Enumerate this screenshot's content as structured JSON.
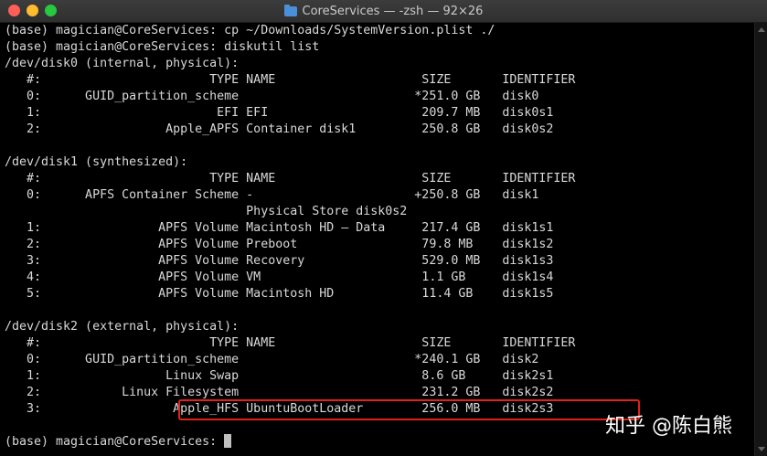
{
  "window": {
    "title": "CoreServices — -zsh — 92×26"
  },
  "terminal": {
    "lines": [
      "(base) magician@CoreServices: cp ~/Downloads/SystemVersion.plist ./",
      "(base) magician@CoreServices: diskutil list",
      "/dev/disk0 (internal, physical):",
      "   #:                       TYPE NAME                    SIZE       IDENTIFIER",
      "   0:      GUID_partition_scheme                        *251.0 GB   disk0",
      "   1:                        EFI EFI                     209.7 MB   disk0s1",
      "   2:                 Apple_APFS Container disk1         250.8 GB   disk0s2",
      "",
      "/dev/disk1 (synthesized):",
      "   #:                       TYPE NAME                    SIZE       IDENTIFIER",
      "   0:      APFS Container Scheme -                      +250.8 GB   disk1",
      "                                 Physical Store disk0s2",
      "   1:                APFS Volume Macintosh HD — Data     217.4 GB   disk1s1",
      "   2:                APFS Volume Preboot                 79.8 MB    disk1s2",
      "   3:                APFS Volume Recovery                529.0 MB   disk1s3",
      "   4:                APFS Volume VM                      1.1 GB     disk1s4",
      "   5:                APFS Volume Macintosh HD            11.4 GB    disk1s5",
      "",
      "/dev/disk2 (external, physical):",
      "   #:                       TYPE NAME                    SIZE       IDENTIFIER",
      "   0:      GUID_partition_scheme                        *240.1 GB   disk2",
      "   1:                 Linux Swap                         8.6 GB     disk2s1",
      "   2:           Linux Filesystem                         231.2 GB   disk2s2",
      "   3:                  Apple_HFS UbuntuBootLoader        256.0 MB   disk2s3",
      "",
      "(base) magician@CoreServices: "
    ]
  },
  "watermark": {
    "text": "知乎 @陈白熊"
  },
  "colors": {
    "background": "#000000",
    "text": "#d9d9d9",
    "highlight_border": "#e3201b",
    "close": "#ff5f57",
    "minimize": "#febc2e",
    "zoom": "#28c840"
  }
}
